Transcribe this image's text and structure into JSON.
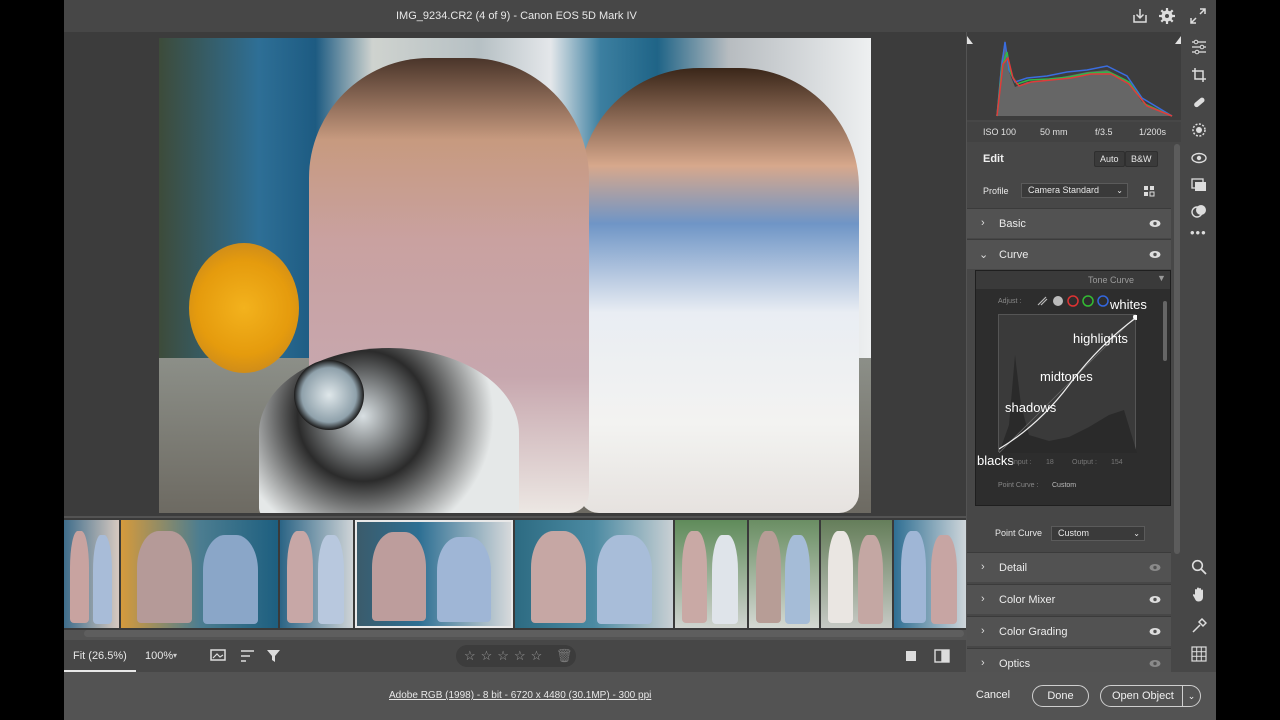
{
  "titlebar": {
    "title": "IMG_9234.CR2 (4 of 9)  -  Canon EOS 5D Mark IV"
  },
  "exif": {
    "iso": "ISO 100",
    "focal": "50 mm",
    "aperture": "f/3.5",
    "shutter": "1/200s"
  },
  "edit": {
    "title": "Edit",
    "auto": "Auto",
    "bw": "B&W",
    "profile_label": "Profile",
    "profile_value": "Camera Standard"
  },
  "sections": {
    "basic": "Basic",
    "curve": "Curve",
    "detail": "Detail",
    "color_mixer": "Color Mixer",
    "color_grading": "Color Grading",
    "optics": "Optics"
  },
  "curve_embed": {
    "header": "Tone Curve",
    "adjust": "Adjust :",
    "labels": [
      "whites",
      "highlights",
      "midtones",
      "shadows",
      "blacks"
    ],
    "input_label": "Input :",
    "input_value": "18",
    "output_label": "Output :",
    "output_value": "154",
    "point_curve_label": "Point Curve :",
    "point_curve_value": "Custom"
  },
  "point_curve": {
    "label": "Point Curve",
    "value": "Custom"
  },
  "toolbar": {
    "fit": "Fit (26.5%)",
    "zoom100": "100%"
  },
  "status": {
    "info": "Adobe RGB (1998) - 8 bit - 6720 x 4480 (30.1MP) - 300 ppi",
    "cancel": "Cancel",
    "done": "Done",
    "open": "Open Object"
  },
  "colors": {
    "bg": "#535353",
    "panel": "#474747",
    "section": "#525252"
  }
}
